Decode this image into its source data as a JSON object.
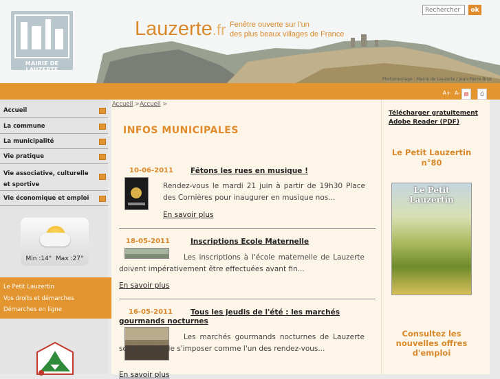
{
  "header": {
    "logo_caption": "MAIRIE DE LAUZERTE",
    "site_name": "Lauzerte",
    "site_tld": ".fr",
    "tagline_line1": "Fenêtre ouverte sur l'un",
    "tagline_line2": "des plus beaux villages de France",
    "photo_credit": "Photomontage : Mairie de Lauzerte / Jean-Pierre Brus",
    "search_placeholder": "Rechercher",
    "search_button": "ok"
  },
  "toolbar": {
    "font_increase": "A+",
    "font_decrease": "A-"
  },
  "sidebar": {
    "items": [
      {
        "label": "Accueil"
      },
      {
        "label": "La commune"
      },
      {
        "label": "La municipalité"
      },
      {
        "label": "Vie pratique"
      },
      {
        "label": "Vie associative, culturelle et sportive"
      },
      {
        "label": "Vie économique et emploi"
      }
    ],
    "weather": {
      "min": "Min :14°",
      "max": "Max :27°"
    },
    "quick_links": [
      "Le Petit Lauzertin",
      "Vos droits et démarches",
      "Démarches en ligne"
    ]
  },
  "breadcrumb": {
    "home": "Accueil",
    "sep": " >",
    "current": "Accueil",
    "sep2": " >"
  },
  "main": {
    "title": "INFOS MUNICIPALES",
    "news": [
      {
        "date": "10-06-2011",
        "title": "Fêtons les rues en musique !",
        "text": "Rendez-vous le mardi 21 juin à partir de 19h30 Place des Cornières pour inaugurer en musique nos...",
        "more": "En savoir plus"
      },
      {
        "date": "18-05-2011",
        "title": "Inscriptions Ecole Maternelle",
        "text": "Les inscriptions à l'école maternelle de Lauzerte doivent impérativement être effectuées avant fin...",
        "more": "En savoir plus"
      },
      {
        "date": "16-05-2011",
        "title": "Tous les jeudis de l'été : les marchés gourmands nocturnes",
        "text": "Les marchés gourmands nocturnes de Lauzerte sont en voie de s'imposer comme l'un des rendez-vous...",
        "more": "En savoir plus"
      }
    ]
  },
  "right": {
    "download_link": "Télécharger gratuitement Adobe Reader (PDF)",
    "petit_title": "Le Petit Lauzertin n°80",
    "petit_cover_title": "Le Petit Lauzertin",
    "emploi_title": "Consultez les nouvelles offres d'emploi"
  },
  "colors": {
    "accent": "#e3952f",
    "title": "#e08a2b"
  }
}
